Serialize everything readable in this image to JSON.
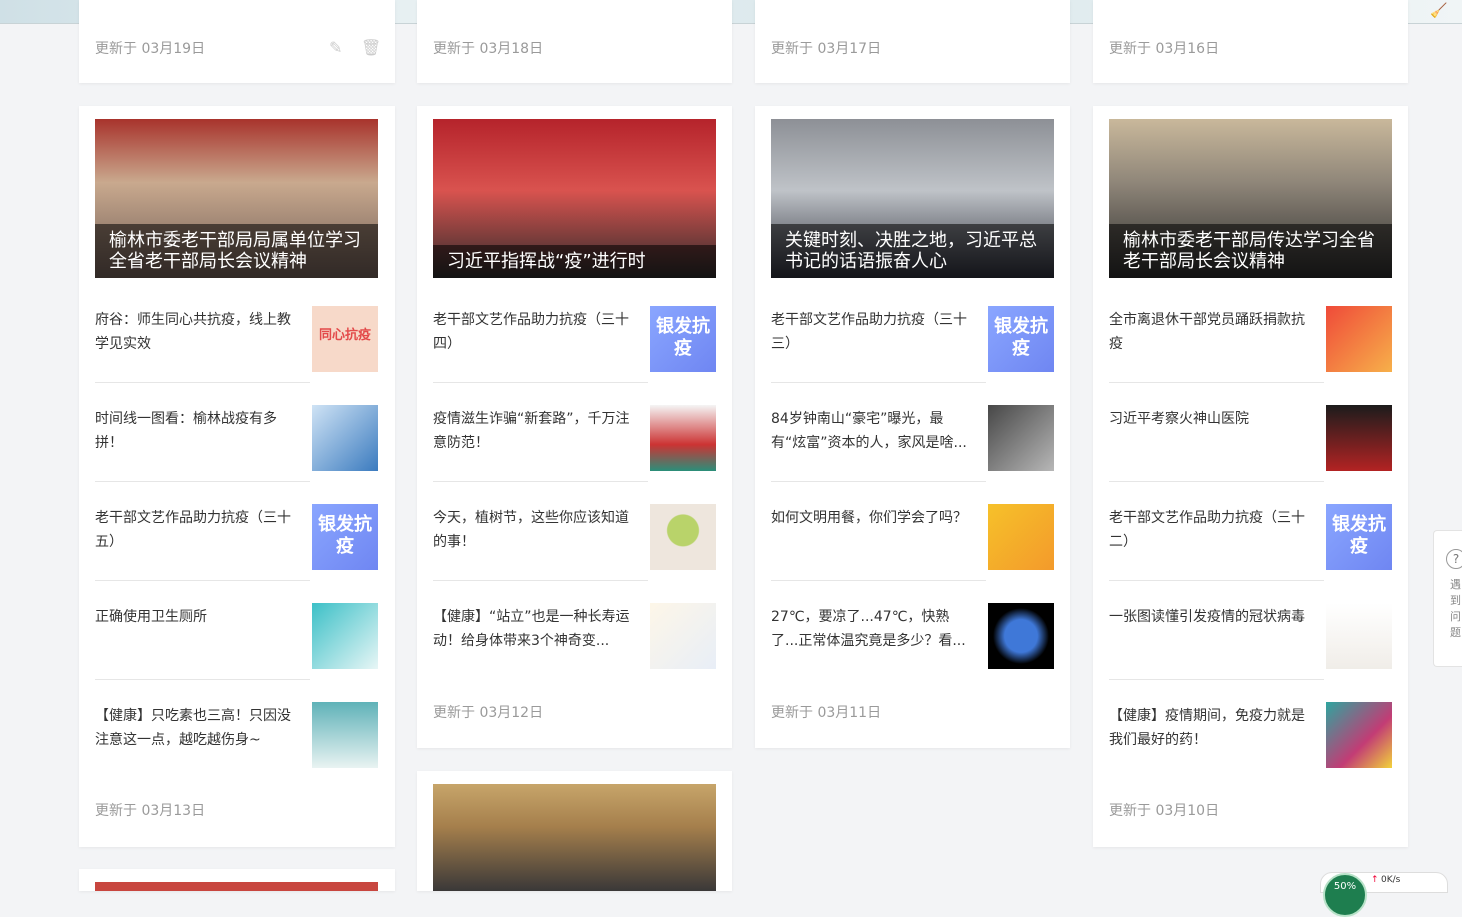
{
  "colors": {
    "background": "#f3f4f6",
    "card": "#ffffff",
    "muted_text": "#9a9a9a",
    "silver_badge": "#7b90f5"
  },
  "top_row": [
    {
      "updated": "更新于 03月19日",
      "has_tools": true
    },
    {
      "updated": "更新于 03月18日"
    },
    {
      "updated": "更新于 03月17日"
    },
    {
      "updated": "更新于 03月16日"
    }
  ],
  "columns": [
    {
      "hero_caption": "榆林市委老干部局局属单位学习全省老干部局长会议精神",
      "items": [
        {
          "title": "府谷：师生同心共抗疫，线上教学见实效",
          "thumb_text": "同心抗疫"
        },
        {
          "title": "时间线一图看：榆林战疫有多拼！"
        },
        {
          "title": "老干部文艺作品助力抗疫（三十五）",
          "thumb_text": "银发抗疫"
        },
        {
          "title": "正确使用卫生厕所"
        },
        {
          "title": "【健康】只吃素也三高！只因没注意这一点，越吃越伤身~"
        }
      ],
      "updated": "更新于 03月13日"
    },
    {
      "hero_caption": "习近平指挥战“疫”进行时",
      "items": [
        {
          "title": "老干部文艺作品助力抗疫（三十四）",
          "thumb_text": "银发抗疫"
        },
        {
          "title": "疫情滋生诈骗“新套路”，千万注意防范！"
        },
        {
          "title": "今天，植树节，这些你应该知道的事！"
        },
        {
          "title": "【健康】“站立”也是一种长寿运动！给身体带来3个神奇变..."
        }
      ],
      "updated": "更新于 03月12日"
    },
    {
      "hero_caption": "关键时刻、决胜之地，习近平总书记的话语振奋人心",
      "items": [
        {
          "title": "老干部文艺作品助力抗疫（三十三）",
          "thumb_text": "银发抗疫"
        },
        {
          "title": "84岁钟南山“豪宅”曝光，最有“炫富”资本的人，家风是啥..."
        },
        {
          "title": "如何文明用餐，你们学会了吗？"
        },
        {
          "title": "27℃，要凉了...47℃，快熟了...正常体温究竟是多少？看..."
        }
      ],
      "updated": "更新于 03月11日"
    },
    {
      "hero_caption": "榆林市委老干部局传达学习全省老干部局长会议精神",
      "items": [
        {
          "title": "全市离退休干部党员踊跃捐款抗疫"
        },
        {
          "title": "习近平考察火神山医院"
        },
        {
          "title": "老干部文艺作品助力抗疫（三十二）",
          "thumb_text": "银发抗疫"
        },
        {
          "title": "一张图读懂引发疫情的冠状病毒"
        },
        {
          "title": "【健康】疫情期间，免疫力就是我们最好的药！"
        }
      ],
      "updated": "更新于 03月10日"
    }
  ],
  "help_widget": {
    "text": "遇到问题"
  },
  "net_widget": {
    "percent": "50%",
    "speed": "0K/s"
  }
}
